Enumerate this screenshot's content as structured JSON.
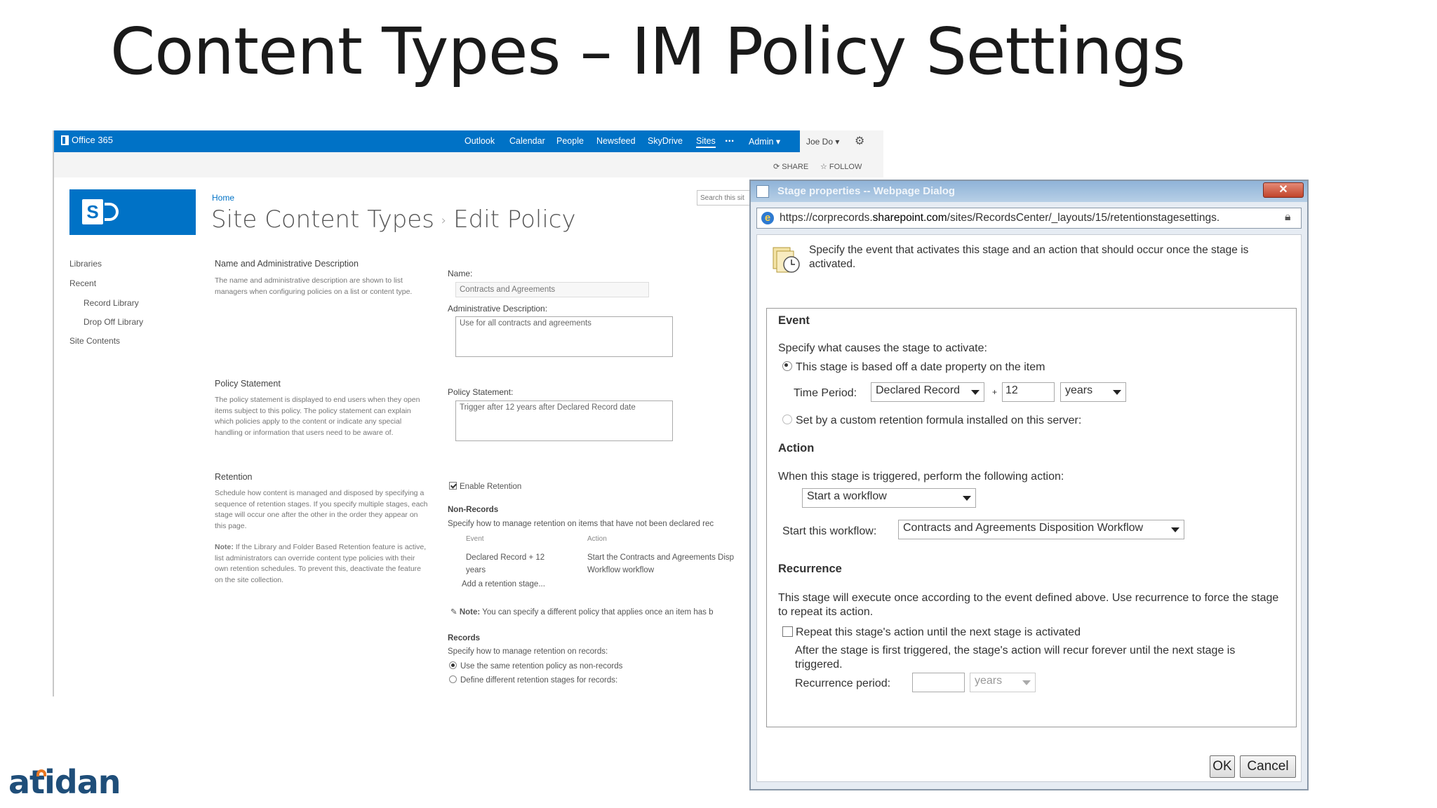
{
  "slide": {
    "title": "Content Types – IM Policy Settings",
    "brand": "atidan"
  },
  "o365": {
    "logo": "Office 365",
    "nav": [
      "Outlook",
      "Calendar",
      "People",
      "Newsfeed",
      "SkyDrive",
      "Sites",
      "...",
      "Admin ▾"
    ],
    "user": "Joe Do ▾",
    "share": "SHARE",
    "follow": "FOLLOW"
  },
  "sp": {
    "breadcrumb": "Home",
    "title_part1": "Site Content Types",
    "title_sep": "›",
    "title_part2": "Edit Policy",
    "search_placeholder": "Search this sit",
    "leftnav": {
      "libraries": "Libraries",
      "recent": "Recent",
      "record_library": "Record Library",
      "drop_off": "Drop Off Library",
      "site_contents": "Site Contents"
    },
    "name_section": {
      "heading": "Name and Administrative Description",
      "desc": "The name and administrative description are shown to list managers when configuring policies on a list or content type."
    },
    "name_label": "Name:",
    "name_value": "Contracts and Agreements",
    "admin_label": "Administrative Description:",
    "admin_value": "Use for all contracts and agreements",
    "policy_section": {
      "heading": "Policy Statement",
      "desc": "The policy statement is displayed to end users when they open items subject to this policy. The policy statement can explain which policies apply to the content or indicate any special handling or information that users need to be aware of."
    },
    "policy_label": "Policy Statement:",
    "policy_value": "Trigger after 12 years after Declared Record date",
    "retention_section": {
      "heading": "Retention",
      "desc": "Schedule how content is managed and disposed by specifying a sequence of retention stages. If you specify multiple stages, each stage will occur one after the other in the order they appear on this page.",
      "note_label": "Note:",
      "note": " If the Library and Folder Based Retention feature is active, list administrators can override content type policies with their own retention schedules.  To prevent this, deactivate the feature on the site collection."
    },
    "enable_retention": "Enable Retention",
    "nonrecords_heading": "Non-Records",
    "nonrecords_desc": "Specify how to manage retention on items that have not been declared rec",
    "col_event": "Event",
    "col_action": "Action",
    "stage_event": "Declared Record + 12 years",
    "stage_action": "Start the Contracts and Agreements Disp Workflow workflow",
    "add_stage": "Add a retention stage...",
    "note2_label": "Note:",
    "note2": " You can specify a different policy that applies once an item has b",
    "records_heading": "Records",
    "records_desc": "Specify how to manage retention on records:",
    "records_opt1": "Use the same retention policy as non-records",
    "records_opt2": "Define different retention stages for records:"
  },
  "dialog": {
    "title": "Stage properties -- Webpage Dialog",
    "close": "✕",
    "url_prefix": "https://corprecords.",
    "url_domain": "sharepoint.com",
    "url_suffix": "/sites/RecordsCenter/_layouts/15/retentionstagesettings.",
    "intro": "Specify the event that activates this stage and an action that should occur once the stage is activated.",
    "event_heading": "Event",
    "event_desc": "Specify what causes the stage to activate:",
    "opt_date": "This stage is based off a date property on the item",
    "time_period_label": "Time Period:",
    "time_property": "Declared Record",
    "plus": "+",
    "time_value": "12",
    "time_unit": "years",
    "opt_custom": "Set by a custom retention formula installed on this server:",
    "action_heading": "Action",
    "action_desc": "When this stage is triggered, perform the following action:",
    "action_value": "Start a workflow",
    "workflow_label": "Start this workflow:",
    "workflow_value": "Contracts and Agreements Disposition Workflow",
    "recurrence_heading": "Recurrence",
    "recurrence_desc": "This stage will execute once according to the event defined above. Use recurrence to force the stage to repeat its action.",
    "repeat_label": "Repeat this stage's action until the next stage is activated",
    "repeat_desc": "After the stage is first triggered, the stage's action will recur forever until the next stage is triggered.",
    "recurrence_period_label": "Recurrence period:",
    "recurrence_value": "",
    "recurrence_unit": "years",
    "ok": "OK",
    "cancel": "Cancel"
  }
}
